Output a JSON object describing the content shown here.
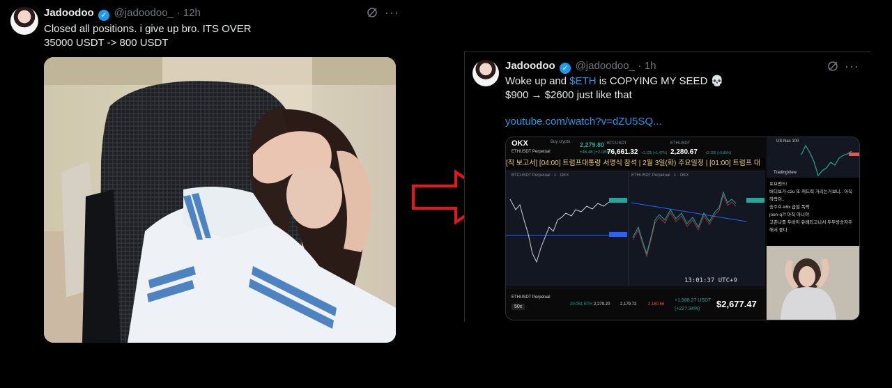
{
  "left_tweet": {
    "display_name": "Jadoodoo",
    "handle": "@jadoodoo_",
    "separator": "·",
    "time": "12h",
    "text_line1": "Closed all positions. i give up bro. ITS OVER",
    "text_line2": "35000 USDT -> 800 USDT"
  },
  "right_tweet": {
    "display_name": "Jadoodoo",
    "handle": "@jadoodoo_",
    "separator": "·",
    "time": "1h",
    "text_line1_pre": "Woke up and ",
    "cashtag": "$ETH",
    "text_line1_post": " is COPYING MY SEED 💀",
    "text_line2": "$900 → $2600 just like that",
    "link": "youtube.com/watch?v=dZU5SQ..."
  },
  "stream": {
    "exchange_logo": "OKX",
    "buy_crypto": "Buy crypto",
    "pair": "ETHUSDT Perpetual",
    "price1": "2,279.80",
    "change1": "+46.48 (+2.08%)",
    "btc_label": "BTCUSDT",
    "btc_price": "76,661.32",
    "btc_change": "+1,125 (+1.47%)",
    "eth_label": "ETHUSDT",
    "eth_price": "2,280.67",
    "eth_change": "+2.105 (+0.85%)",
    "us_nas": "US Nas 100",
    "ticker_text": "[직 보고서] [04:00] 트럼프대통령 서명식 참석 | 2월 3일(화) 주요일정 | [01:00] 트럼프 대",
    "chart1_title": "BTCUSDT Perpetual · 1 · OKX",
    "chart2_title": "ETHUSDT Perpetual · 1 · OKX",
    "clock": "13:01:37 UTC+9",
    "pos_pair": "ETHUSDT Perpetual",
    "leverage": "50x",
    "pos_size": "20.051 ETH",
    "pos_entry": "2,279.20",
    "pos_mark": "2,179.72",
    "pos_liq": "2,160.66",
    "pnl": "+1,988.27 USDT",
    "pnl_pct": "(+227.34%)",
    "balance": "$2,677.47",
    "tradingview": "TradingView",
    "chat": [
      "포요밴드!",
      "버디보가-c2u 또 캐드릭 거리는거보니.. 아직 하락이..",
      "송주호-k6x 급밀 폭락",
      "joon-q7f 아직 아니야",
      "고존나를 두바이 유배되고나서 두두방송자주해서 좋다"
    ]
  },
  "colors": {
    "background": "#000000",
    "text": "#e7e9ea",
    "muted": "#71767b",
    "link": "#1d9bf0",
    "arrow": "#e8161b",
    "up": "#26a69a",
    "down": "#ef5350"
  }
}
